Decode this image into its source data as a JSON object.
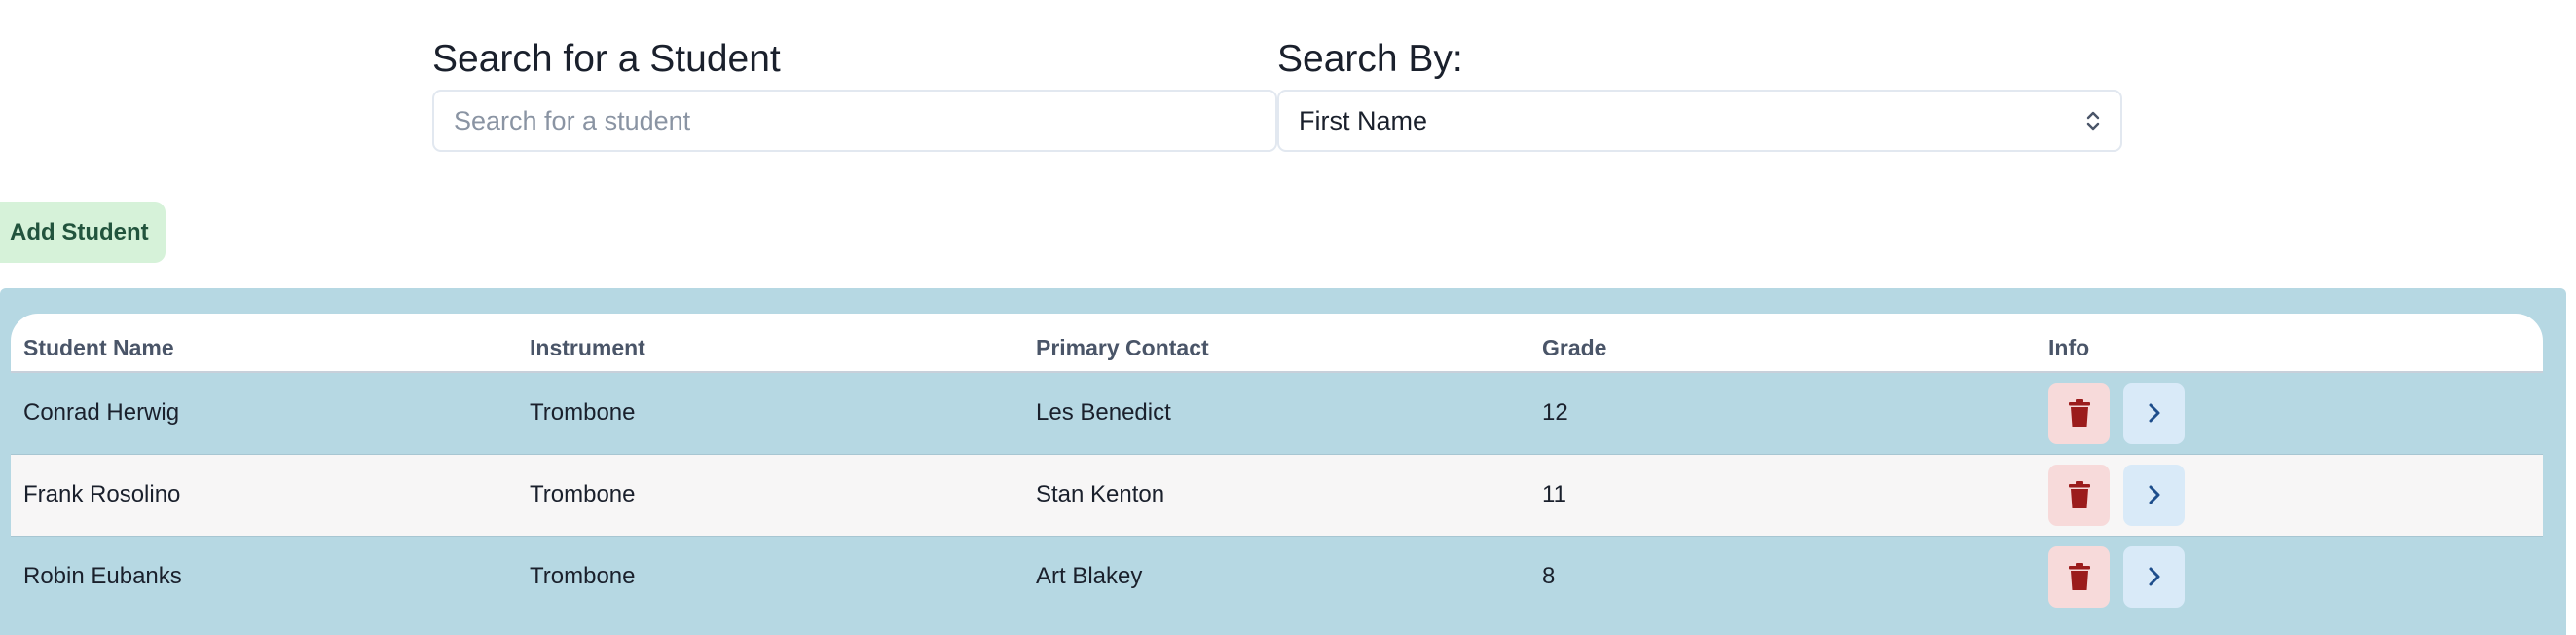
{
  "search": {
    "heading": "Search for a Student",
    "placeholder": "Search for a student",
    "value": ""
  },
  "search_by": {
    "heading": "Search By:",
    "selected": "First Name"
  },
  "actions": {
    "add_label": "Add Student"
  },
  "table": {
    "headers": [
      "Student Name",
      "Instrument",
      "Primary Contact",
      "Grade",
      "Info"
    ],
    "rows": [
      {
        "name": "Conrad Herwig",
        "instrument": "Trombone",
        "contact": "Les Benedict",
        "grade": "12"
      },
      {
        "name": "Frank Rosolino",
        "instrument": "Trombone",
        "contact": "Stan Kenton",
        "grade": "11"
      },
      {
        "name": "Robin Eubanks",
        "instrument": "Trombone",
        "contact": "Art Blakey",
        "grade": "8"
      }
    ]
  },
  "icons": {
    "delete": "trash-icon",
    "open": "chevron-right-icon",
    "select": "chevron-up-down-icon"
  },
  "colors": {
    "table_bg": "#b6d8e3",
    "add_button_bg": "#d6f2d9",
    "delete_icon": "#9b1c1c",
    "open_icon": "#1e4e8c"
  }
}
